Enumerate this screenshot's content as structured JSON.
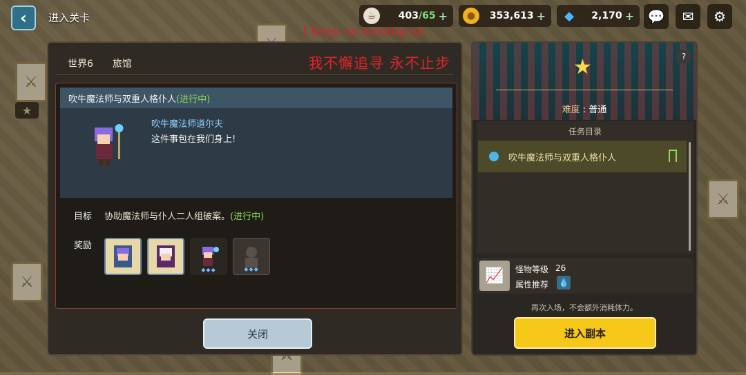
{
  "topbar": {
    "title": "进入关卡",
    "stamina_current": "403",
    "stamina_sep": "/",
    "stamina_max": "65",
    "gold": "353,613",
    "gems": "2,170",
    "overlay_text_en": "I keep on holding on"
  },
  "left": {
    "tab_world": "世界6",
    "tab_inn": "旅馆",
    "overlay_text_cn": "我不懈追寻 永不止步",
    "quest_title": "吹牛魔法师与双重人格仆人",
    "quest_status": "(进行中)",
    "npc_name": "吹牛魔法师道尔夫",
    "npc_line": "这件事包在我们身上!",
    "goal_label": "目标",
    "goal_text": "协助魔法师与仆人二人组破案。",
    "goal_status": "(进行中)",
    "reward_label": "奖励",
    "close_label": "关闭"
  },
  "right": {
    "help_label": "?",
    "difficulty_key": "难度",
    "difficulty_sep": ":",
    "difficulty_val": "普通",
    "list_title": "任务目录",
    "list_item": "吹牛魔法师与双重人格仆人",
    "monster_level_label": "怪物等级",
    "monster_level_value": "26",
    "attribute_label": "属性推荐",
    "reenter_note": "再次入场，不会额外消耗体力。",
    "enter_label": "进入副本"
  },
  "colors": {
    "accent_yellow": "#f6c81a",
    "progress_green": "#8fdc5a",
    "npc_blue": "#8fd0ff"
  }
}
